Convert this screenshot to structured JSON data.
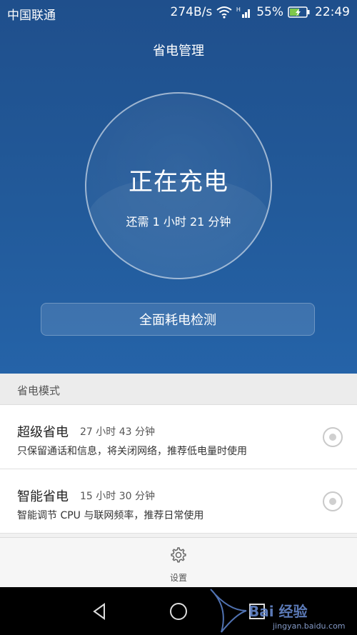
{
  "status_bar": {
    "carrier": "中国联通",
    "speed": "274B/s",
    "battery_percent": "55%",
    "time": "22:49",
    "icons": [
      "wifi-icon",
      "signal-icon",
      "battery-charging-icon"
    ]
  },
  "header": {
    "title": "省电管理"
  },
  "charging": {
    "headline": "正在充电",
    "remaining": "还需 1 小时 21 分钟"
  },
  "detect_button": {
    "label": "全面耗电检测"
  },
  "modes_section": {
    "title": "省电模式",
    "items": [
      {
        "name": "超级省电",
        "time": "27 小时 43 分钟",
        "description": "只保留通话和信息，将关闭网络，推荐低电量时使用"
      },
      {
        "name": "智能省电",
        "time": "15 小时 30 分钟",
        "description": "智能调节 CPU 与联网频率，推荐日常使用"
      }
    ]
  },
  "settings": {
    "label": "设置",
    "icon": "gear-icon"
  },
  "navigation": {
    "icons": [
      "back-icon",
      "home-icon",
      "recents-icon"
    ]
  },
  "watermark": {
    "text": "Bai 经验",
    "url": "jingyan.baidu.com"
  },
  "colors": {
    "header_bg": "#225a9a",
    "white": "#ffffff"
  }
}
